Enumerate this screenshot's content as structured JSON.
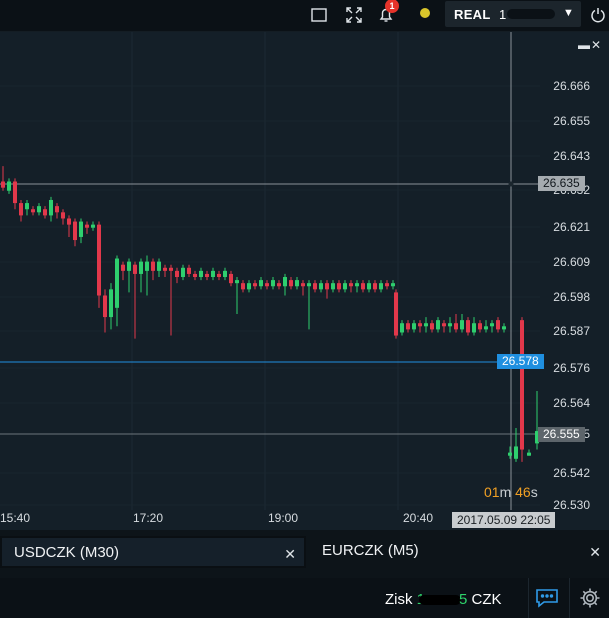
{
  "topbar": {
    "icons": [
      "window-icon",
      "fullscreen-icon",
      "bell-icon",
      "power-icon"
    ],
    "notification_count": "1",
    "status_color": "#d9c52b",
    "account": {
      "type": "REAL",
      "number_visible": "1"
    }
  },
  "chart": {
    "crosshair_price": "26.635",
    "current_price": "26.578",
    "last_price_label": "26.555",
    "crosshair_time": "2017.05.09 22:05",
    "countdown": {
      "minutes": "01",
      "minutes_unit": "m",
      "seconds": "46",
      "seconds_unit": "s"
    }
  },
  "chart_data": {
    "type": "candlestick",
    "y_ticks": [
      "26.666",
      "26.655",
      "26.643",
      "26.632",
      "26.621",
      "26.609",
      "26.598",
      "26.587",
      "26.576",
      "26.564",
      "26.555",
      "26.542",
      "26.530"
    ],
    "ylim": [
      26.53,
      26.672
    ],
    "x_ticks": [
      "15:40",
      "17:20",
      "19:00",
      "20:40"
    ],
    "grid": true,
    "colors": {
      "up": "#2ecf6e",
      "down": "#e2384b",
      "current_line": "#1f8fe0"
    }
  },
  "tabs": [
    {
      "label": "USDCZK (M30)",
      "active": true
    },
    {
      "label": "EURCZK (M5)",
      "active": false
    }
  ],
  "footer": {
    "profit_label": "Zisk",
    "profit_value_prefix": "1",
    "profit_value_suffix": "5",
    "currency": "CZK"
  }
}
